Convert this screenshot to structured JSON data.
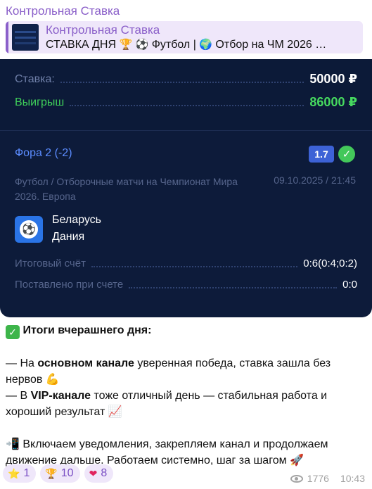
{
  "message": {
    "sender": "Контрольная Ставка",
    "reply": {
      "title": "Контрольная Ставка",
      "text_parts": [
        "СТАВКА ДНЯ ",
        "🏆",
        " ",
        "⚽",
        " Футбол | ",
        "🌍",
        " Отбор на ЧМ 2026",
        " …"
      ]
    }
  },
  "bet_card": {
    "stake_label": "Ставка:",
    "stake_value": "50000 ₽",
    "win_label": "Выигрыш",
    "win_value": "86000 ₽",
    "market": "Фора 2 (-2)",
    "coefficient": "1.7",
    "status_icon": "✓",
    "league": "Футбол / Отборочные матчи на Чемпионат Мира 2026. Европа",
    "datetime": "09.10.2025 / 21:45",
    "sport_icon": "⚽",
    "team_home": "Беларусь",
    "team_away": "Дания",
    "final_score_label": "Итоговый счёт",
    "final_score_value": "0:6(0:4;0:2)",
    "placed_at_label": "Поставлено при счете",
    "placed_at_value": "0:0"
  },
  "text": {
    "check_icon": "✓",
    "heading": "Итоги вчерашнего дня:",
    "p1_pre": "— На ",
    "p1_bold": "основном канале",
    "p1_post": " уверенная победа, ставка зашла без нервов ",
    "p1_emoji": "💪",
    "p2_pre": "— В ",
    "p2_bold": "VIP-канале",
    "p2_post": " тоже отличный день — стабильная работа и хороший результат ",
    "p2_emoji": "📈",
    "p3_emoji": "📲",
    "p3_text": " Включаем уведомления, закрепляем канал и продолжаем движение дальше. Работаем системно, шаг за шагом ",
    "p3_emoji_end": "🚀"
  },
  "reactions": [
    {
      "emoji": "⭐",
      "count": "1"
    },
    {
      "emoji": "🏆",
      "count": "10"
    },
    {
      "emoji": "❤",
      "count": "8"
    }
  ],
  "meta": {
    "views": "1776",
    "time": "10:43"
  },
  "colors": {
    "accent": "#8a5fc9",
    "card_bg": "#0d1b3a",
    "win_green": "#46d95f",
    "market_blue": "#5b8cff",
    "coef_bg": "#3d62d6"
  }
}
